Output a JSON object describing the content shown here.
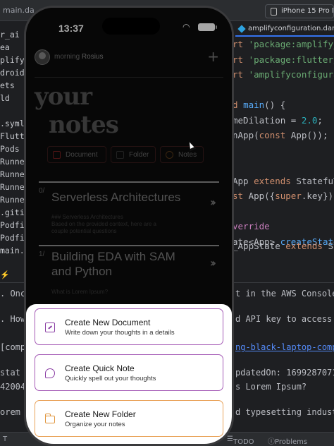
{
  "ide": {
    "left_tab": "main.da",
    "device_selector": "iPhone 15 Pro Max",
    "file_tab": "amplifyconfiguration.dart",
    "file_tree": [
      "r_ai",
      "ea",
      "plify",
      "droid [",
      "ets",
      "ld",
      "",
      ".symlir",
      "Flutte",
      "Pods",
      "Runne",
      "Runne",
      "Runne",
      "Runne",
      ".gitign",
      "Podfile",
      "Podfile",
      "main.dar"
    ],
    "code_lines": [
      {
        "parts": [
          {
            "t": "rt ",
            "c": "kw"
          },
          {
            "t": "'package:amplify_f",
            "c": "str"
          }
        ]
      },
      {
        "parts": [
          {
            "t": "rt ",
            "c": "kw"
          },
          {
            "t": "'package:flutter/s",
            "c": "str"
          }
        ]
      },
      {
        "parts": [
          {
            "t": "rt ",
            "c": "kw"
          },
          {
            "t": "'amplifyconfigurati",
            "c": "str"
          }
        ]
      },
      {
        "parts": [
          {
            "t": "",
            "c": ""
          }
        ]
      },
      {
        "parts": [
          {
            "t": "d ",
            "c": "kw"
          },
          {
            "t": "main",
            "c": "fn"
          },
          {
            "t": "() {",
            "c": ""
          }
        ]
      },
      {
        "parts": [
          {
            "t": "meDilation = ",
            "c": ""
          },
          {
            "t": "2.0",
            "c": "num"
          },
          {
            "t": ";",
            "c": ""
          }
        ]
      },
      {
        "parts": [
          {
            "t": "nApp(",
            "c": ""
          },
          {
            "t": "const ",
            "c": "kw"
          },
          {
            "t": "App());",
            "c": ""
          }
        ]
      },
      {
        "parts": [
          {
            "t": "",
            "c": ""
          }
        ]
      },
      {
        "parts": [
          {
            "t": "",
            "c": ""
          }
        ]
      },
      {
        "parts": [
          {
            "t": " App ",
            "c": ""
          },
          {
            "t": "extends ",
            "c": "kw"
          },
          {
            "t": "StatefuT",
            "c": ""
          }
        ]
      },
      {
        "parts": [
          {
            "t": "st ",
            "c": "kw"
          },
          {
            "t": "App({",
            "c": ""
          },
          {
            "t": "super",
            "c": "kw"
          },
          {
            "t": ".key});",
            "c": ""
          }
        ]
      },
      {
        "parts": [
          {
            "t": "",
            "c": ""
          }
        ]
      },
      {
        "parts": [
          {
            "t": "verride",
            "c": "typ"
          }
        ]
      },
      {
        "parts": [
          {
            "t": "ate<App> ",
            "c": ""
          },
          {
            "t": "createState",
            "c": "fn"
          },
          {
            "t": "()",
            "c": ""
          }
        ]
      }
    ],
    "code_line_appstate": {
      "parts": [
        {
          "t": " _AppState ",
          "c": ""
        },
        {
          "t": "extends ",
          "c": "kw"
        },
        {
          "t": "St",
          "c": ""
        }
      ]
    },
    "console_lines": [
      {
        "text": ". Once",
        "right": "t in the AWS Console?"
      },
      {
        "text": ". How",
        "right": "d API key to access A"
      },
      {
        "text": "[comp",
        "right": "ng-black-laptop-compu",
        "link": true
      },
      {
        "text": " stat",
        "right": "pdatedOn: 1699287071,"
      },
      {
        "text": "42004",
        "right": "s Lorem Ipsum?"
      },
      {
        "text": "orem ",
        "right": "d typesetting industr"
      }
    ],
    "bottom_bar": {
      "terminal": "T",
      "todo": "TODO",
      "problems": "Problems"
    }
  },
  "phone": {
    "time": "13:37",
    "greeting_prefix": "morning ",
    "greeting_name": "Rosius",
    "title_line1": "your",
    "title_line2": "notes",
    "filters": [
      {
        "label": "Document"
      },
      {
        "label": "Folder"
      },
      {
        "label": "Notes"
      }
    ],
    "notes": [
      {
        "index": "0/",
        "title": "Serverless Architectures",
        "excerpt_line1": "### Serverless Architectures",
        "excerpt_line2": "Based on the provided context, here are a",
        "excerpt_line3": "couple potential questions"
      },
      {
        "index": "1/",
        "title": "Building EDA with SAM and Python",
        "excerpt_line1": "What is Lorem Ipsum?"
      }
    ],
    "sheet_options": [
      {
        "title": "Create New Document",
        "subtitle": "Write down your thoughts in a details",
        "icon": "document-edit-icon",
        "accent": "#a55bb6"
      },
      {
        "title": "Create Quick Note",
        "subtitle": "Quickly spell out your thoughts",
        "icon": "quick-note-icon",
        "accent": "#a55bb6"
      },
      {
        "title": "Create New Folder",
        "subtitle": "Organize your notes",
        "icon": "folder-icon",
        "accent": "#e9a35a"
      }
    ]
  }
}
